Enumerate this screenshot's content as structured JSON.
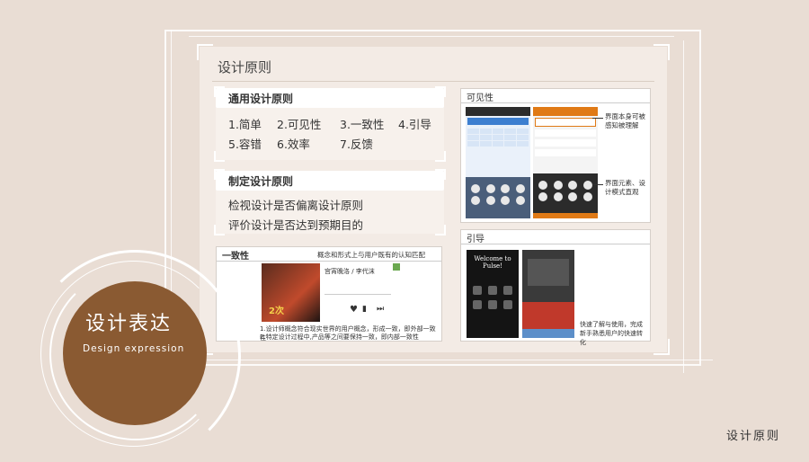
{
  "panel": {
    "title": "设计原则"
  },
  "general_card": {
    "title": "通用设计原则",
    "items": [
      "1.简单",
      "2.可见性",
      "3.一致性",
      "4.引导",
      "5.容错",
      "6.效率",
      "7.反馈"
    ]
  },
  "custom_card": {
    "title": "制定设计原则",
    "lines": [
      "检视设计是否偏离设计原则",
      "评价设计是否达到预期目的"
    ]
  },
  "consistency": {
    "title": "一致性",
    "subtitle": "概念和形式上与用户既有的认知匹配",
    "song_title": "宫宵晚洛 / 李代沫",
    "captions": [
      "1.设计师概念符合现实世界的用户概念，形成一致，即外部一致性",
      "2.特定设计过程中,产品等之间要保持一致，即内部一致性"
    ]
  },
  "visibility": {
    "title": "可见性",
    "notes": [
      "界面本身可被感知被理解",
      "界面元素、设计模式直观"
    ]
  },
  "guide": {
    "title": "引导",
    "welcome": "Welcome to Pulse!",
    "note": "快速了解与使用，完成新手熟悉用户的快速转化"
  },
  "badge": {
    "title": "设计表达",
    "subtitle": "Design expression"
  },
  "footer": {
    "label": "设计原则"
  }
}
